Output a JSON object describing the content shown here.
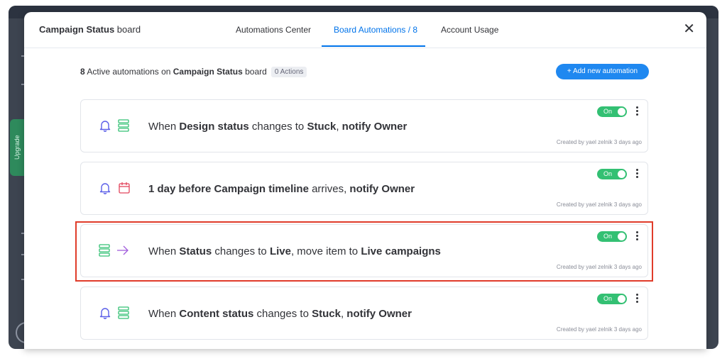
{
  "modal": {
    "title_bold": "Campaign Status",
    "title_rest": " board",
    "tabs": [
      "Automations Center",
      "Board Automations / 8",
      "Account Usage"
    ],
    "active_tab_index": 1,
    "close_icon": "close-icon",
    "close_glyph": "✕"
  },
  "summary": {
    "count": "8",
    "text_mid": " Active automations on ",
    "board_name": "Campaign Status",
    "text_end": " board",
    "actions_badge": "0 Actions"
  },
  "add_button": {
    "label": "+ Add new automation"
  },
  "background": {
    "upgrade_label": "Upgrade"
  },
  "colors": {
    "accent": "#0073ea",
    "toggle_on": "#33c073",
    "highlight_border": "#e03c2a",
    "bell_icon": "#5b5fe8",
    "status_icon": "#33c073",
    "calendar_icon": "#e2445c",
    "arrow_icon": "#a25ddc"
  },
  "automations": [
    {
      "icons": [
        "bell-icon",
        "status-column-icon"
      ],
      "parts": [
        {
          "t": "When ",
          "b": false
        },
        {
          "t": "Design status",
          "b": true
        },
        {
          "t": " changes to ",
          "b": false
        },
        {
          "t": "Stuck",
          "b": true
        },
        {
          "t": ", ",
          "b": false
        },
        {
          "t": "notify Owner",
          "b": true
        }
      ],
      "toggle_label": "On",
      "created": "Created by yael zelnik 3 days ago"
    },
    {
      "icons": [
        "bell-icon",
        "calendar-icon"
      ],
      "parts": [
        {
          "t": "1 day before ",
          "b": true
        },
        {
          "t": "Campaign timeline",
          "b": true
        },
        {
          "t": " arrives, ",
          "b": false
        },
        {
          "t": "notify Owner",
          "b": true
        }
      ],
      "toggle_label": "On",
      "created": "Created by yael zelnik 3 days ago"
    },
    {
      "icons": [
        "status-column-icon",
        "arrow-right-icon"
      ],
      "parts": [
        {
          "t": "When ",
          "b": false
        },
        {
          "t": "Status",
          "b": true
        },
        {
          "t": " changes to ",
          "b": false
        },
        {
          "t": "Live",
          "b": true
        },
        {
          "t": ", move item to ",
          "b": false
        },
        {
          "t": "Live campaigns",
          "b": true
        }
      ],
      "toggle_label": "On",
      "created": "Created by yael zelnik 3 days ago"
    },
    {
      "icons": [
        "bell-icon",
        "status-column-icon"
      ],
      "parts": [
        {
          "t": "When ",
          "b": false
        },
        {
          "t": "Content status",
          "b": true
        },
        {
          "t": " changes to ",
          "b": false
        },
        {
          "t": "Stuck",
          "b": true
        },
        {
          "t": ", ",
          "b": false
        },
        {
          "t": "notify Owner",
          "b": true
        }
      ],
      "toggle_label": "On",
      "created": "Created by yael zelnik 3 days ago"
    }
  ]
}
